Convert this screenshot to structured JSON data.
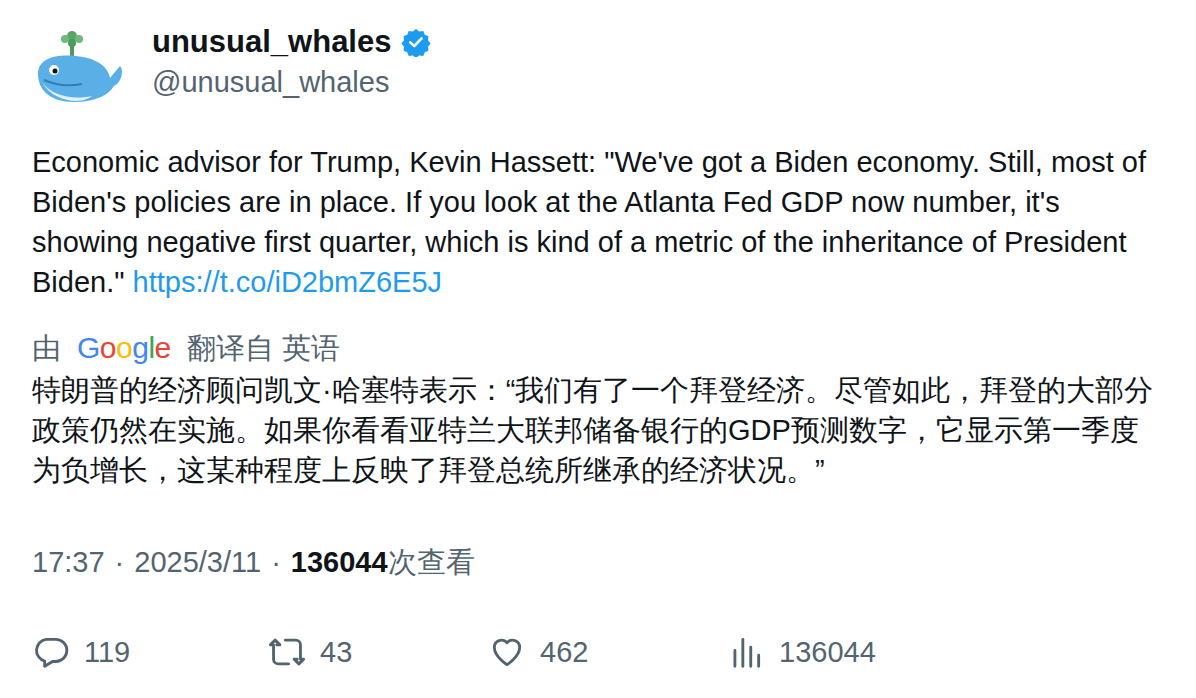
{
  "author": {
    "name": "unusual_whales",
    "handle": "@unusual_whales",
    "verified": true
  },
  "post": {
    "text": "Economic advisor for Trump, Kevin Hassett: \"We've got a Biden economy. Still, most of Biden's policies are in place. If you look at the Atlanta Fed GDP now number, it's showing negative first quarter, which is kind of a metric of the inheritance of President Biden.\"",
    "link": "https://t.co/iD2bmZ6E5J"
  },
  "translation": {
    "prefix": "由",
    "provider": "Google",
    "suffix": "翻译自 英语",
    "text": "特朗普的经济顾问凯文·哈塞特表示：“我们有了一个拜登经济。尽管如此，拜登的大部分政策仍然在实施。如果你看看亚特兰大联邦储备银行的GDP预测数字，它显示第一季度为负增长，这某种程度上反映了拜登总统所继承的经济状况。”"
  },
  "meta": {
    "time": "17:37",
    "separator": "·",
    "date": "2025/3/11",
    "views": "136044",
    "views_label": "次查看"
  },
  "actions": [
    {
      "kind": "reply",
      "count": "119"
    },
    {
      "kind": "repost",
      "count": "43"
    },
    {
      "kind": "like",
      "count": "462"
    },
    {
      "kind": "views",
      "count": "136044"
    }
  ]
}
